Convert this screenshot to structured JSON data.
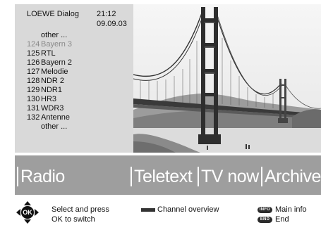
{
  "header": {
    "title": "LOEWE Dialog",
    "time": "21:12",
    "date": "09.09.03"
  },
  "channels": [
    {
      "number": "",
      "name": "other ..."
    },
    {
      "number": "124",
      "name": "Bayern 3",
      "state": "current"
    },
    {
      "number": "125",
      "name": "RTL"
    },
    {
      "number": "126",
      "name": "Bayern 2"
    },
    {
      "number": "127",
      "name": "Melodie"
    },
    {
      "number": "128",
      "name": "NDR 2"
    },
    {
      "number": "129",
      "name": "NDR1"
    },
    {
      "number": "130",
      "name": "HR3"
    },
    {
      "number": "131",
      "name": "WDR3"
    },
    {
      "number": "132",
      "name": "Antenne"
    },
    {
      "number": "",
      "name": "other ..."
    }
  ],
  "menu": {
    "radio": "Radio",
    "teletext": "Teletext",
    "tv_now": "TV now",
    "archive": "Archive"
  },
  "footer": {
    "ok_label": "OK",
    "select_line1": "Select and press",
    "select_line2": "OK to switch",
    "channel_overview": "Channel overview",
    "info_key": "INFO",
    "info_label": "Main info",
    "end_key": "END",
    "end_label": "End"
  },
  "colors": {
    "panel_bg": "#d9d9d9",
    "menu_bg": "#9e9e9e",
    "dim_text": "#8a8a8a",
    "dark": "#2b2b2b"
  }
}
